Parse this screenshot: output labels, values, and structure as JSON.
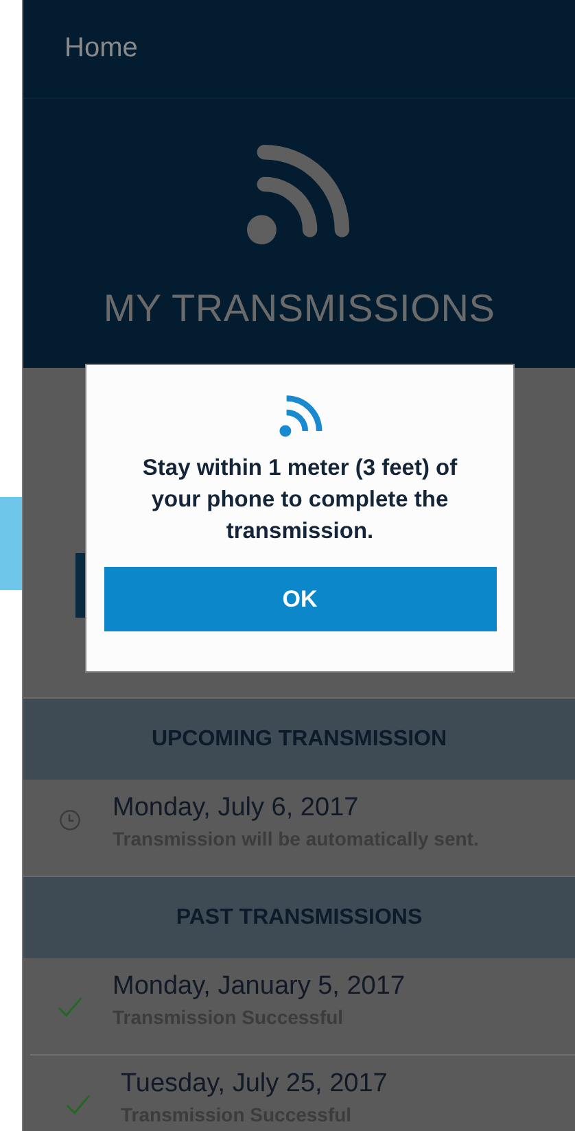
{
  "header": {
    "nav_link": "Home",
    "title": "MY TRANSMISSIONS"
  },
  "sections": [
    {
      "heading": "UPCOMING TRANSMISSION",
      "items": [
        {
          "kind": "scheduled",
          "date": "Monday, July 6, 2017",
          "detail": "Transmission will be automatically sent."
        }
      ]
    },
    {
      "heading": "PAST TRANSMISSIONS",
      "items": [
        {
          "kind": "success",
          "date": "Monday, January 5, 2017",
          "detail": "Transmission Successful"
        },
        {
          "kind": "success",
          "date": "Tuesday, July 25, 2017",
          "detail": "Transmission Successful"
        }
      ]
    }
  ],
  "dialog": {
    "message": "Stay within 1 meter (3 feet) of your phone to complete the transmission.",
    "button": "OK"
  }
}
